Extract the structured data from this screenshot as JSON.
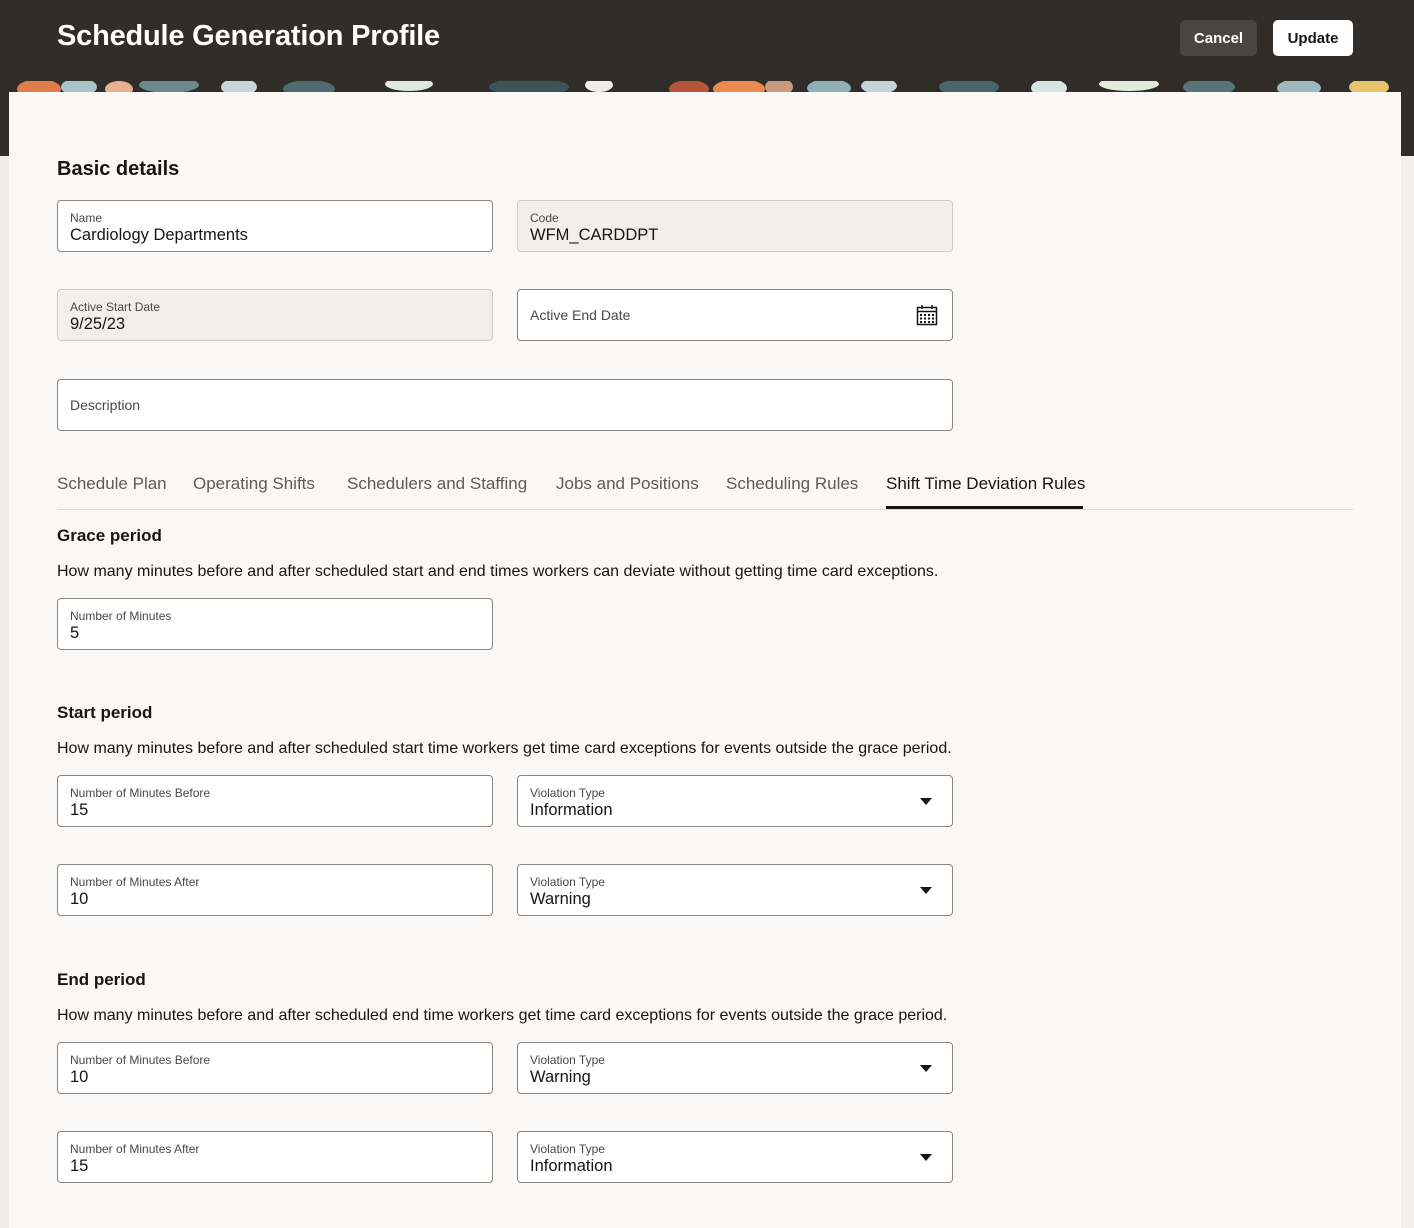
{
  "header": {
    "title": "Schedule Generation Profile",
    "cancel_label": "Cancel",
    "update_label": "Update"
  },
  "basic_details": {
    "title": "Basic details",
    "name": {
      "label": "Name",
      "value": "Cardiology Departments"
    },
    "code": {
      "label": "Code",
      "value": "WFM_CARDDPT"
    },
    "active_start_date": {
      "label": "Active Start Date",
      "value": "9/25/23"
    },
    "active_end_date": {
      "label": "Active End Date",
      "value": ""
    },
    "description": {
      "label": "Description",
      "value": ""
    }
  },
  "tabs": [
    {
      "label": "Schedule Plan"
    },
    {
      "label": "Operating Shifts"
    },
    {
      "label": "Schedulers and Staffing"
    },
    {
      "label": "Jobs and Positions"
    },
    {
      "label": "Scheduling Rules"
    },
    {
      "label": "Shift Time Deviation Rules",
      "active": true
    }
  ],
  "grace_period": {
    "title": "Grace period",
    "description": "How many minutes before and after scheduled start and end times workers can deviate without getting time card exceptions.",
    "minutes": {
      "label": "Number of Minutes",
      "value": "5"
    }
  },
  "start_period": {
    "title": "Start period",
    "description": "How many minutes before and after scheduled start time workers get time card exceptions for events outside the grace period.",
    "before": {
      "label": "Number of Minutes Before",
      "value": "15"
    },
    "before_violation": {
      "label": "Violation Type",
      "value": "Information"
    },
    "after": {
      "label": "Number of Minutes After",
      "value": "10"
    },
    "after_violation": {
      "label": "Violation Type",
      "value": "Warning"
    }
  },
  "end_period": {
    "title": "End period",
    "description": "How many minutes before and after scheduled end time workers get time card exceptions for events outside the grace period.",
    "before": {
      "label": "Number of Minutes Before",
      "value": "10"
    },
    "before_violation": {
      "label": "Violation Type",
      "value": "Warning"
    },
    "after": {
      "label": "Number of Minutes After",
      "value": "15"
    },
    "after_violation": {
      "label": "Violation Type",
      "value": "Information"
    }
  },
  "icons": {
    "calendar": "calendar-icon",
    "dropdown": "chevron-down-icon"
  },
  "colors": {
    "header_bg": "#312d2a",
    "panel_bg": "#f9f8f6",
    "text": "#161513",
    "active_tab_underline": "#161513"
  }
}
